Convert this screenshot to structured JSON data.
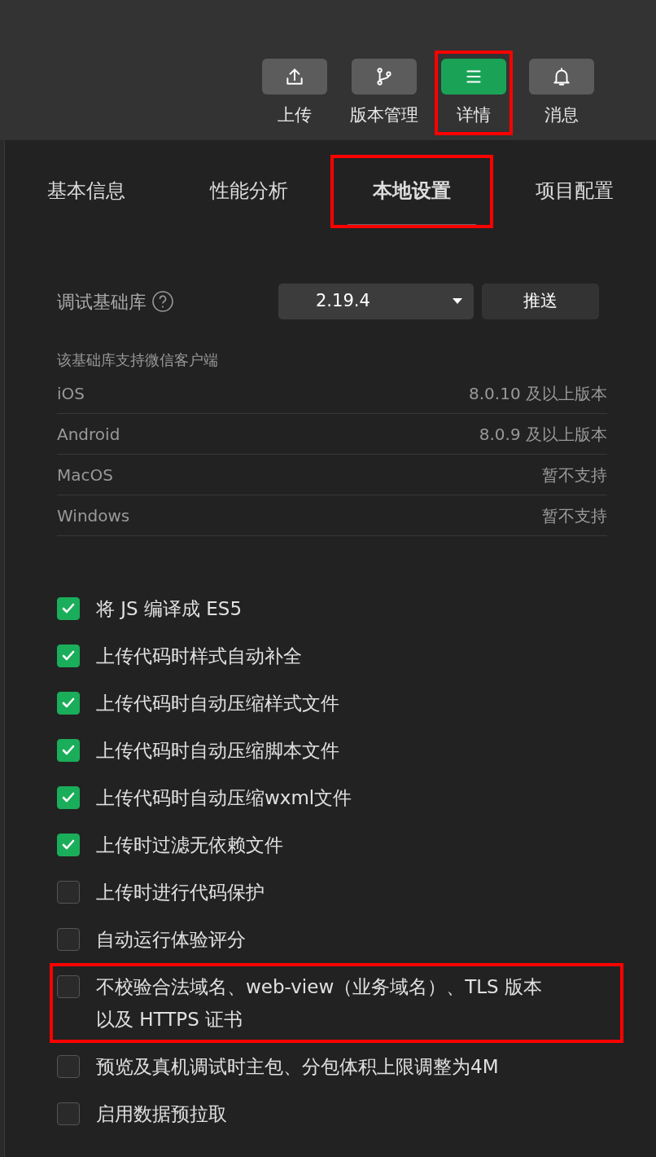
{
  "toolbar": {
    "buttons": [
      {
        "label": "上传",
        "kind": "upload",
        "selected": false,
        "highlighted": false
      },
      {
        "label": "版本管理",
        "kind": "branch",
        "selected": false,
        "highlighted": false
      },
      {
        "label": "详情",
        "kind": "menu",
        "selected": true,
        "highlighted": true
      },
      {
        "label": "消息",
        "kind": "bell",
        "selected": false,
        "highlighted": false
      }
    ]
  },
  "tabs": [
    {
      "label": "基本信息",
      "selected": false,
      "highlighted": false
    },
    {
      "label": "性能分析",
      "selected": false,
      "highlighted": false
    },
    {
      "label": "本地设置",
      "selected": true,
      "highlighted": true
    },
    {
      "label": "项目配置",
      "selected": false,
      "highlighted": false
    }
  ],
  "debug_library": {
    "label": "调试基础库",
    "version": "2.19.4",
    "push_button": "推送"
  },
  "support": {
    "heading": "该基础库支持微信客户端",
    "rows": [
      {
        "platform": "iOS",
        "value": "8.0.10 及以上版本"
      },
      {
        "platform": "Android",
        "value": "8.0.9 及以上版本"
      },
      {
        "platform": "MacOS",
        "value": "暂不支持"
      },
      {
        "platform": "Windows",
        "value": "暂不支持"
      }
    ]
  },
  "options": [
    {
      "label": "将 JS 编译成 ES5",
      "checked": true,
      "highlighted": false
    },
    {
      "label": "上传代码时样式自动补全",
      "checked": true,
      "highlighted": false
    },
    {
      "label": "上传代码时自动压缩样式文件",
      "checked": true,
      "highlighted": false
    },
    {
      "label": "上传代码时自动压缩脚本文件",
      "checked": true,
      "highlighted": false
    },
    {
      "label": "上传代码时自动压缩wxml文件",
      "checked": true,
      "highlighted": false
    },
    {
      "label": "上传时过滤无依赖文件",
      "checked": true,
      "highlighted": false
    },
    {
      "label": "上传时进行代码保护",
      "checked": false,
      "highlighted": false
    },
    {
      "label": "自动运行体验评分",
      "checked": false,
      "highlighted": false
    },
    {
      "label": "不校验合法域名、web-view（业务域名）、TLS 版本以及 HTTPS 证书",
      "checked": false,
      "highlighted": true
    },
    {
      "label": "预览及真机调试时主包、分包体积上限调整为4M",
      "checked": false,
      "highlighted": false
    },
    {
      "label": "启用数据预拉取",
      "checked": false,
      "highlighted": false
    }
  ]
}
